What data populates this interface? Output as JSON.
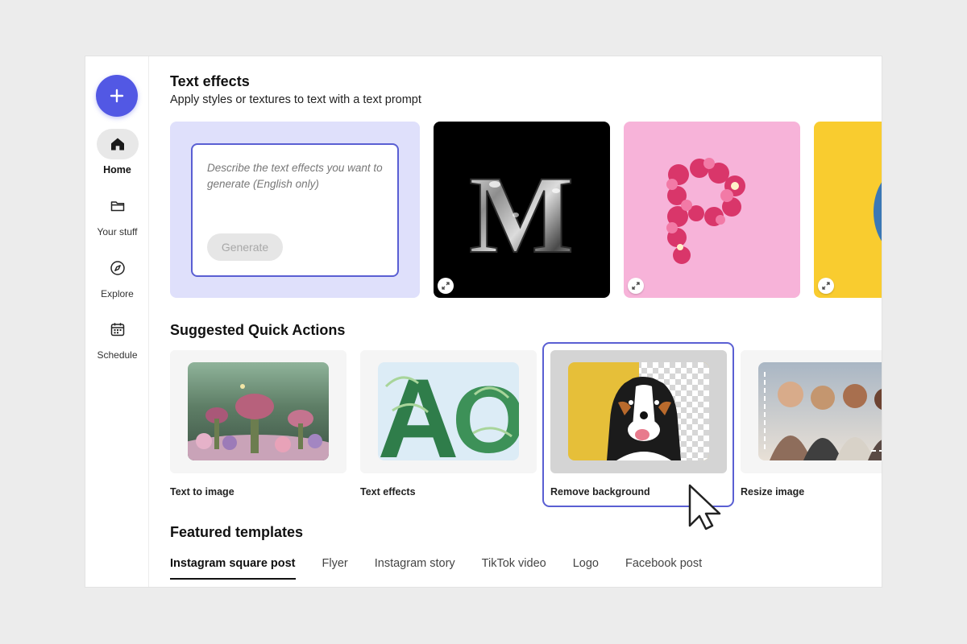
{
  "sidebar": {
    "create_icon": "plus-icon",
    "items": [
      {
        "label": "Home",
        "icon": "home-icon",
        "active": true
      },
      {
        "label": "Your stuff",
        "icon": "folder-icon",
        "active": false
      },
      {
        "label": "Explore",
        "icon": "compass-icon",
        "active": false
      },
      {
        "label": "Schedule",
        "icon": "calendar-icon",
        "active": false
      }
    ]
  },
  "text_effects": {
    "title": "Text effects",
    "subtitle": "Apply styles or textures to text with a text prompt",
    "prompt_placeholder": "Describe the text effects you want to generate (English only)",
    "generate_label": "Generate",
    "samples": [
      {
        "letter": "M",
        "style": "chrome",
        "background": "#000000"
      },
      {
        "letter": "P",
        "style": "flowers",
        "background": "#f7b3d9"
      },
      {
        "letter": "",
        "style": "denim",
        "background": "#f9cc2f"
      }
    ]
  },
  "quick_actions": {
    "title": "Suggested Quick Actions",
    "items": [
      {
        "label": "Text to image"
      },
      {
        "label": "Text effects"
      },
      {
        "label": "Remove background",
        "highlighted": true
      },
      {
        "label": "Resize image"
      }
    ]
  },
  "templates": {
    "title": "Featured templates",
    "tabs": [
      {
        "label": "Instagram square post",
        "active": true
      },
      {
        "label": "Flyer"
      },
      {
        "label": "Instagram story"
      },
      {
        "label": "TikTok video"
      },
      {
        "label": "Logo"
      },
      {
        "label": "Facebook post"
      }
    ]
  },
  "colors": {
    "accent": "#5258e4",
    "highlight_border": "#5a5fd3",
    "prompt_card_bg": "#dfe0fb"
  }
}
